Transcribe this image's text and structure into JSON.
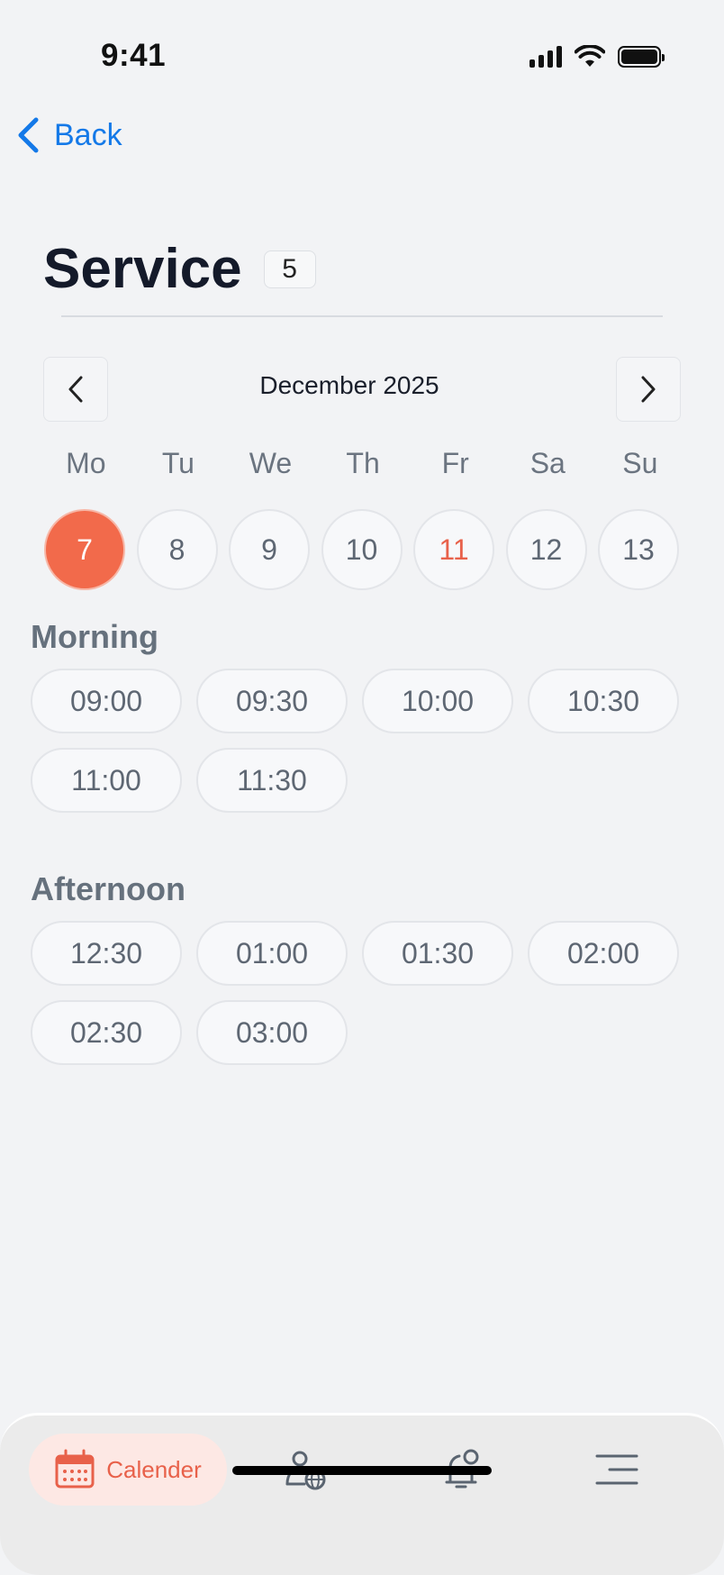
{
  "status_bar": {
    "time": "9:41"
  },
  "nav": {
    "back_label": "Back"
  },
  "header": {
    "title": "Service",
    "count": "5"
  },
  "calendar": {
    "month_label": "December 2025",
    "weekdays": [
      "Mo",
      "Tu",
      "We",
      "Th",
      "Fr",
      "Sa",
      "Su"
    ],
    "days": [
      {
        "label": "7",
        "state": "selected"
      },
      {
        "label": "8",
        "state": "normal"
      },
      {
        "label": "9",
        "state": "normal"
      },
      {
        "label": "10",
        "state": "normal"
      },
      {
        "label": "11",
        "state": "highlight"
      },
      {
        "label": "12",
        "state": "normal"
      },
      {
        "label": "13",
        "state": "normal"
      }
    ]
  },
  "morning": {
    "title": "Morning",
    "slots": [
      "09:00",
      "09:30",
      "10:00",
      "10:30",
      "11:00",
      "11:30"
    ]
  },
  "afternoon": {
    "title": "Afternoon",
    "slots": [
      "12:30",
      "01:00",
      "01:30",
      "02:00",
      "02:30",
      "03:00"
    ]
  },
  "tabbar": {
    "items": [
      {
        "label": "Calender",
        "icon": "calendar-icon",
        "active": true
      },
      {
        "label": "",
        "icon": "user-globe-icon",
        "active": false
      },
      {
        "label": "",
        "icon": "bell-icon",
        "active": false
      },
      {
        "label": "",
        "icon": "menu-icon",
        "active": false
      }
    ]
  },
  "colors": {
    "accent": "#f26a4b",
    "link": "#1479e8",
    "background": "#f2f3f5",
    "muted_text": "#5e6773"
  }
}
